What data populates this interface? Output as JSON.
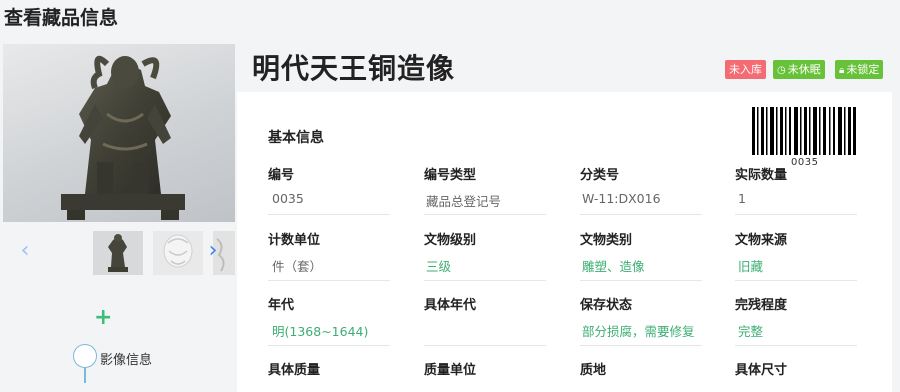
{
  "page": {
    "title": "查看藏品信息"
  },
  "object": {
    "name": "明代天王铜造像"
  },
  "badges": {
    "storage": "未入库",
    "sleep": "未休眠",
    "lock": "未锁定"
  },
  "gallery": {
    "prev": "‹",
    "next": "›",
    "add": "+",
    "image_info": "影像信息"
  },
  "basic": {
    "section_title": "基本信息",
    "barcode_number": "0035",
    "rows": [
      [
        {
          "label": "编号",
          "value": "0035",
          "green": false
        },
        {
          "label": "编号类型",
          "value": "藏品总登记号",
          "green": false
        },
        {
          "label": "分类号",
          "value": "W-11:DX016",
          "green": false
        },
        {
          "label": "实际数量",
          "value": "1",
          "green": false
        }
      ],
      [
        {
          "label": "计数单位",
          "value": "件（套）",
          "green": false
        },
        {
          "label": "文物级别",
          "value": "三级",
          "green": true
        },
        {
          "label": "文物类别",
          "value": "雕塑、造像",
          "green": true
        },
        {
          "label": "文物来源",
          "value": "旧藏",
          "green": true
        }
      ],
      [
        {
          "label": "年代",
          "value": "明(1368~1644)",
          "green": true
        },
        {
          "label": "具体年代",
          "value": "",
          "green": false
        },
        {
          "label": "保存状态",
          "value": "部分损腐，需要修复",
          "green": true
        },
        {
          "label": "完残程度",
          "value": "完整",
          "green": true
        }
      ],
      [
        {
          "label": "具体质量",
          "value": "",
          "green": false
        },
        {
          "label": "质量单位",
          "value": "",
          "green": false
        },
        {
          "label": "质地",
          "value": "",
          "green": false
        },
        {
          "label": "具体尺寸",
          "value": "",
          "green": false
        }
      ]
    ]
  },
  "colors": {
    "red_badge": "#f36b73",
    "green_badge": "#67c23a",
    "green_text": "#3dae74",
    "link_blue": "#3b83e6"
  }
}
